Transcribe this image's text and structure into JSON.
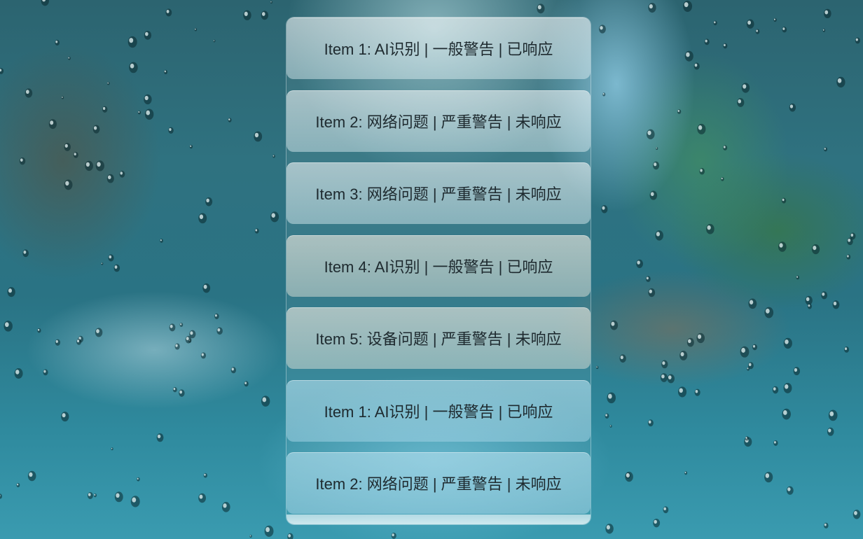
{
  "list": {
    "items": [
      {
        "label": "Item 1: AI识别 | 一般警告 | 已响应"
      },
      {
        "label": "Item 2: 网络问题 | 严重警告 | 未响应"
      },
      {
        "label": "Item 3: 网络问题 | 严重警告 | 未响应"
      },
      {
        "label": "Item 4: AI识别 | 一般警告 | 已响应"
      },
      {
        "label": "Item 5: 设备问题 | 严重警告 | 未响应"
      },
      {
        "label": "Item 1: AI识别 | 一般警告 | 已响应"
      },
      {
        "label": "Item 2: 网络问题 | 严重警告 | 未响应"
      }
    ]
  }
}
